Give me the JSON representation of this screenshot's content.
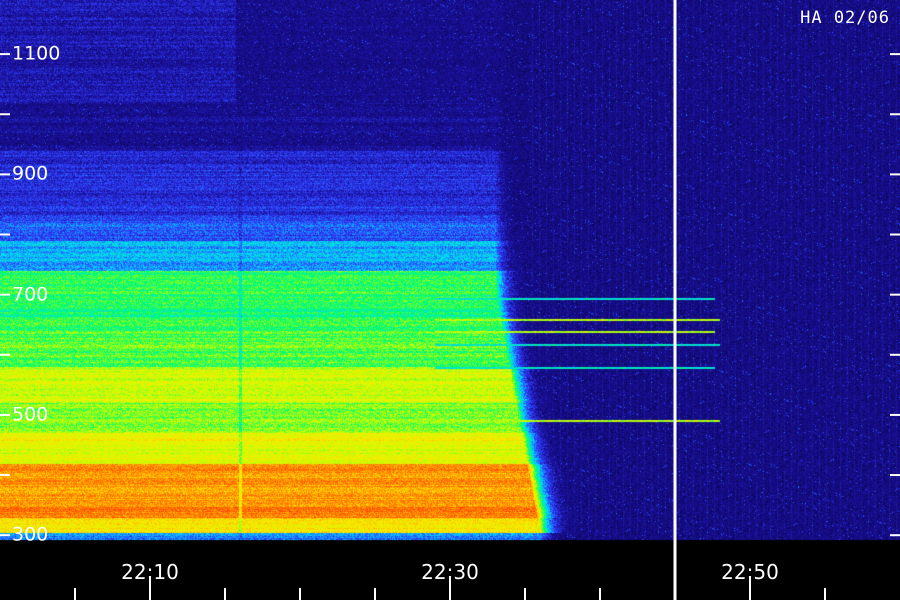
{
  "chart_data": {
    "type": "heatmap",
    "title": "HA 02/06",
    "xlabel": "",
    "ylabel": "",
    "x_unit": "time (HH:MM)",
    "xlim_minutes": [
      1320,
      1380
    ],
    "ylim": [
      292,
      1190
    ],
    "y_tick_labels": [
      "300",
      "500",
      "700",
      "900",
      "1100"
    ],
    "y_tick_values": [
      300,
      500,
      700,
      900,
      1100
    ],
    "y_minor_tick_values": [
      400,
      600,
      800,
      1000,
      1200
    ],
    "x_tick_labels": [
      "22:10",
      "22:30",
      "22:50"
    ],
    "x_tick_minutes": [
      1330,
      1350,
      1370
    ],
    "x_minor_tick_step_minutes": 5,
    "marker_line_time": "22:45",
    "burst": {
      "start": "22:00",
      "gap_time": "22:16",
      "fade_time": "22:33",
      "fade_end_time": "22:36"
    },
    "narrowband_lines_mhz": [
      695,
      660,
      640,
      618,
      580,
      492
    ],
    "grid": false,
    "colormap": [
      "#000022",
      "#1a0f99",
      "#3040ff",
      "#00d8ff",
      "#00ff66",
      "#ccff00",
      "#ffe600",
      "#ff7a00",
      "#ff2000"
    ],
    "colors": {
      "background": "#000010",
      "marker": "#ffffff",
      "text": "#ffffff"
    }
  }
}
